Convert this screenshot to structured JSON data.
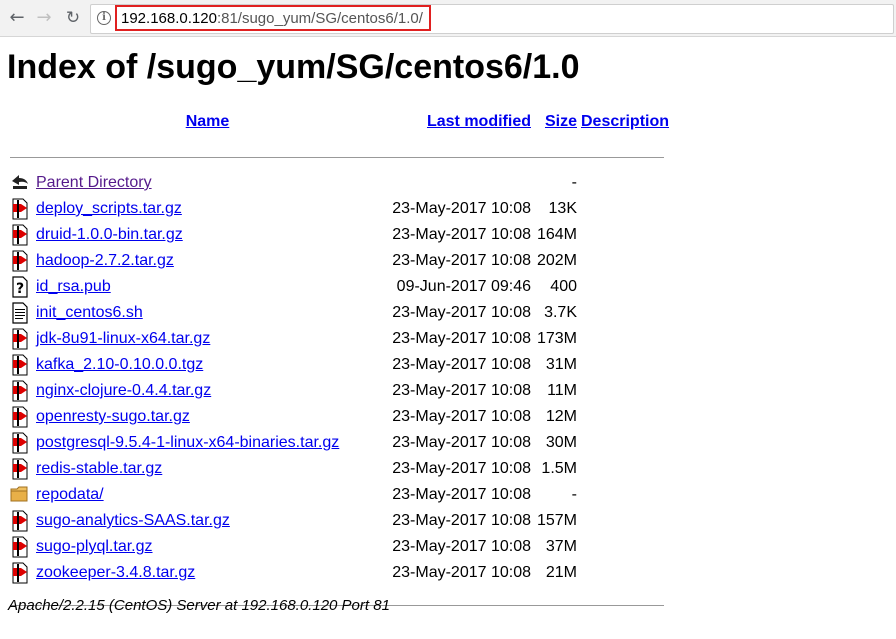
{
  "browser": {
    "back_icon": "←",
    "forward_icon": "→",
    "reload_icon": "↻",
    "info_icon": "i",
    "url_host": "192.168.0.120",
    "url_rest": ":81/sugo_yum/SG/centos6/1.0/"
  },
  "page": {
    "title": "Index of /sugo_yum/SG/centos6/1.0",
    "headers": {
      "name": "Name",
      "last_modified": "Last modified",
      "size": "Size",
      "description": "Description"
    },
    "rows": [
      {
        "icon": "back-arrow-icon",
        "name": "Parent Directory",
        "modified": "",
        "size": "-"
      },
      {
        "icon": "compressed-file-icon",
        "name": "deploy_scripts.tar.gz",
        "modified": "23-May-2017 10:08",
        "size": "13K"
      },
      {
        "icon": "compressed-file-icon",
        "name": "druid-1.0.0-bin.tar.gz",
        "modified": "23-May-2017 10:08",
        "size": "164M"
      },
      {
        "icon": "compressed-file-icon",
        "name": "hadoop-2.7.2.tar.gz",
        "modified": "23-May-2017 10:08",
        "size": "202M"
      },
      {
        "icon": "unknown-file-icon",
        "name": "id_rsa.pub",
        "modified": "09-Jun-2017 09:46",
        "size": "400"
      },
      {
        "icon": "text-file-icon",
        "name": "init_centos6.sh",
        "modified": "23-May-2017 10:08",
        "size": "3.7K"
      },
      {
        "icon": "compressed-file-icon",
        "name": "jdk-8u91-linux-x64.tar.gz",
        "modified": "23-May-2017 10:08",
        "size": "173M"
      },
      {
        "icon": "compressed-file-icon",
        "name": "kafka_2.10-0.10.0.0.tgz",
        "modified": "23-May-2017 10:08",
        "size": "31M"
      },
      {
        "icon": "compressed-file-icon",
        "name": "nginx-clojure-0.4.4.tar.gz",
        "modified": "23-May-2017 10:08",
        "size": "11M"
      },
      {
        "icon": "compressed-file-icon",
        "name": "openresty-sugo.tar.gz",
        "modified": "23-May-2017 10:08",
        "size": "12M"
      },
      {
        "icon": "compressed-file-icon",
        "name": "postgresql-9.5.4-1-linux-x64-binaries.tar.gz",
        "modified": "23-May-2017 10:08",
        "size": "30M"
      },
      {
        "icon": "compressed-file-icon",
        "name": "redis-stable.tar.gz",
        "modified": "23-May-2017 10:08",
        "size": "1.5M"
      },
      {
        "icon": "folder-icon",
        "name": "repodata/",
        "modified": "23-May-2017 10:08",
        "size": "-"
      },
      {
        "icon": "compressed-file-icon",
        "name": "sugo-analytics-SAAS.tar.gz",
        "modified": "23-May-2017 10:08",
        "size": "157M"
      },
      {
        "icon": "compressed-file-icon",
        "name": "sugo-plyql.tar.gz",
        "modified": "23-May-2017 10:08",
        "size": "37M"
      },
      {
        "icon": "compressed-file-icon",
        "name": "zookeeper-3.4.8.tar.gz",
        "modified": "23-May-2017 10:08",
        "size": "21M"
      }
    ],
    "footer": "Apache/2.2.15 (CentOS) Server at 192.168.0.120 Port 81"
  },
  "colors": {
    "link": "#0000ee",
    "visited_link": "#551a8b",
    "url_highlight": "#e02020"
  }
}
